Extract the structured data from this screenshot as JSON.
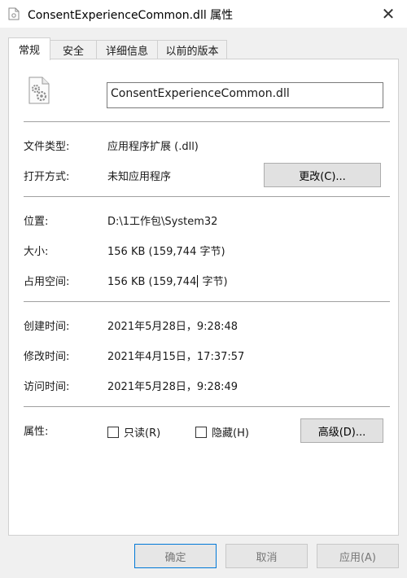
{
  "window": {
    "title": "ConsentExperienceCommon.dll 属性",
    "close_glyph": "✕"
  },
  "tabs": [
    {
      "label": "常规",
      "active": true
    },
    {
      "label": "安全",
      "active": false
    },
    {
      "label": "详细信息",
      "active": false
    },
    {
      "label": "以前的版本",
      "active": false
    }
  ],
  "general": {
    "file_name": "ConsentExperienceCommon.dll",
    "type_label": "文件类型:",
    "type_value": "应用程序扩展 (.dll)",
    "opens_with_label": "打开方式:",
    "opens_with_value": "未知应用程序",
    "change_button": "更改(C)...",
    "location_label": "位置:",
    "location_value": "D:\\1工作包\\System32",
    "size_label": "大小:",
    "size_value": "156 KB (159,744 字节)",
    "size_on_disk_label": "占用空间:",
    "size_on_disk_value_a": "156 KB (159,744",
    "size_on_disk_value_b": "字节)",
    "created_label": "创建时间:",
    "created_value": "2021年5月28日，9:28:48",
    "modified_label": "修改时间:",
    "modified_value": "2021年4月15日，17:37:57",
    "accessed_label": "访问时间:",
    "accessed_value": "2021年5月28日，9:28:49",
    "attributes_label": "属性:",
    "readonly_label": "只读(R)",
    "hidden_label": "隐藏(H)",
    "advanced_button": "高级(D)..."
  },
  "footer": {
    "ok": "确定",
    "cancel": "取消",
    "apply": "应用(A)"
  },
  "icons": {
    "title_icon": "file-icon",
    "dll_icon": "dll-gear-file-icon"
  }
}
